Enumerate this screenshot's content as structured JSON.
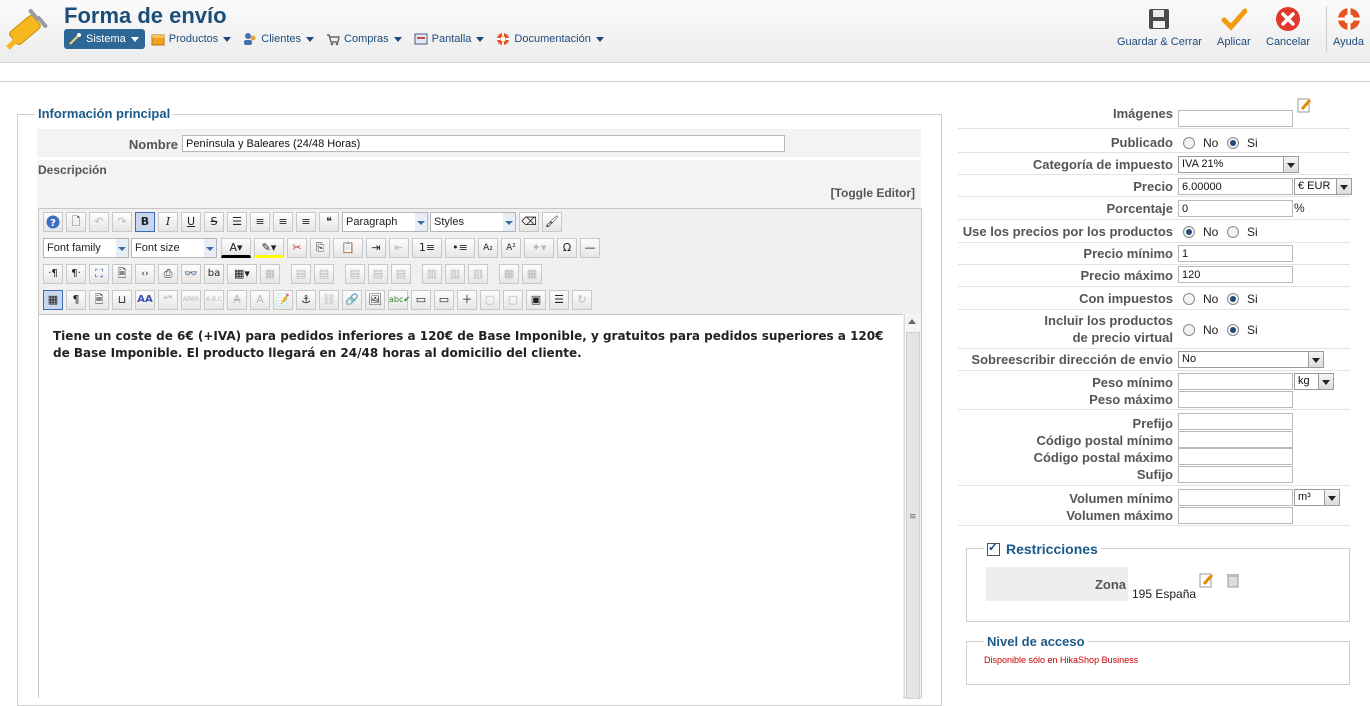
{
  "header": {
    "title": "Forma de envío",
    "menu": [
      {
        "label": "Sistema",
        "icon": "wand-icon"
      },
      {
        "label": "Productos",
        "icon": "box-icon"
      },
      {
        "label": "Clientes",
        "icon": "users-icon"
      },
      {
        "label": "Compras",
        "icon": "cart-icon"
      },
      {
        "label": "Pantalla",
        "icon": "screen-icon"
      },
      {
        "label": "Documentación",
        "icon": "lifebuoy-icon"
      }
    ],
    "toolbar": {
      "save_close": "Guardar & Cerrar",
      "apply": "Aplicar",
      "cancel": "Cancelar",
      "help": "Ayuda"
    }
  },
  "main": {
    "legend": "Información principal",
    "name_label": "Nombre",
    "name_value": "Península y Baleares (24/48 Horas)",
    "description_label": "Descripción",
    "toggle_editor": "[Toggle Editor]",
    "editor": {
      "format_select": "Paragraph",
      "styles_select": "Styles",
      "font_family_select": "Font family",
      "font_size_select": "Font size",
      "content": "Tiene un coste de 6€ (+IVA) para pedidos inferiores a 120€ de Base Imponible, y gratuitos para pedidos superiores a 120€ de Base Imponible. El producto llegará en 24/48 horas al domicilio del cliente."
    }
  },
  "side": {
    "images_label": "Imágenes",
    "published_label": "Publicado",
    "no": "No",
    "yes": "Si",
    "tax_category_label": "Categoría de impuesto",
    "tax_category_value": "IVA 21%",
    "price_label": "Precio",
    "price_value": "6.00000",
    "currency_value": "€ EUR",
    "percent_label": "Porcentaje",
    "percent_value": "0",
    "percent_symbol": "%",
    "use_product_prices_label": "Use los precios por los productos",
    "min_price_label": "Precio mínimo",
    "min_price_value": "1",
    "max_price_label": "Precio máximo",
    "max_price_value": "120",
    "with_taxes_label": "Con impuestos",
    "include_virtual_label_1": "Incluir los productos",
    "include_virtual_label_2": "de precio virtual",
    "override_address_label": "Sobreescribir dirección de envio",
    "override_address_value": "No",
    "min_weight_label": "Peso mínimo",
    "max_weight_label": "Peso máximo",
    "weight_unit": "kg",
    "prefix_label": "Prefijo",
    "min_zip_label": "Código postal mínimo",
    "max_zip_label": "Código postal máximo",
    "suffix_label": "Sufijo",
    "min_volume_label": "Volumen mínimo",
    "max_volume_label": "Volumen máximo",
    "volume_unit": "m³",
    "restrictions_legend": "Restricciones",
    "zone_label": "Zona",
    "zone_value": "195 España",
    "access_legend": "Nivel de acceso",
    "access_note": "Disponible sólo en HikaShop Business"
  },
  "colors": {
    "accent": "#1c4e7a",
    "active_menu": "#2d6796",
    "note_red": "#cc0000"
  }
}
